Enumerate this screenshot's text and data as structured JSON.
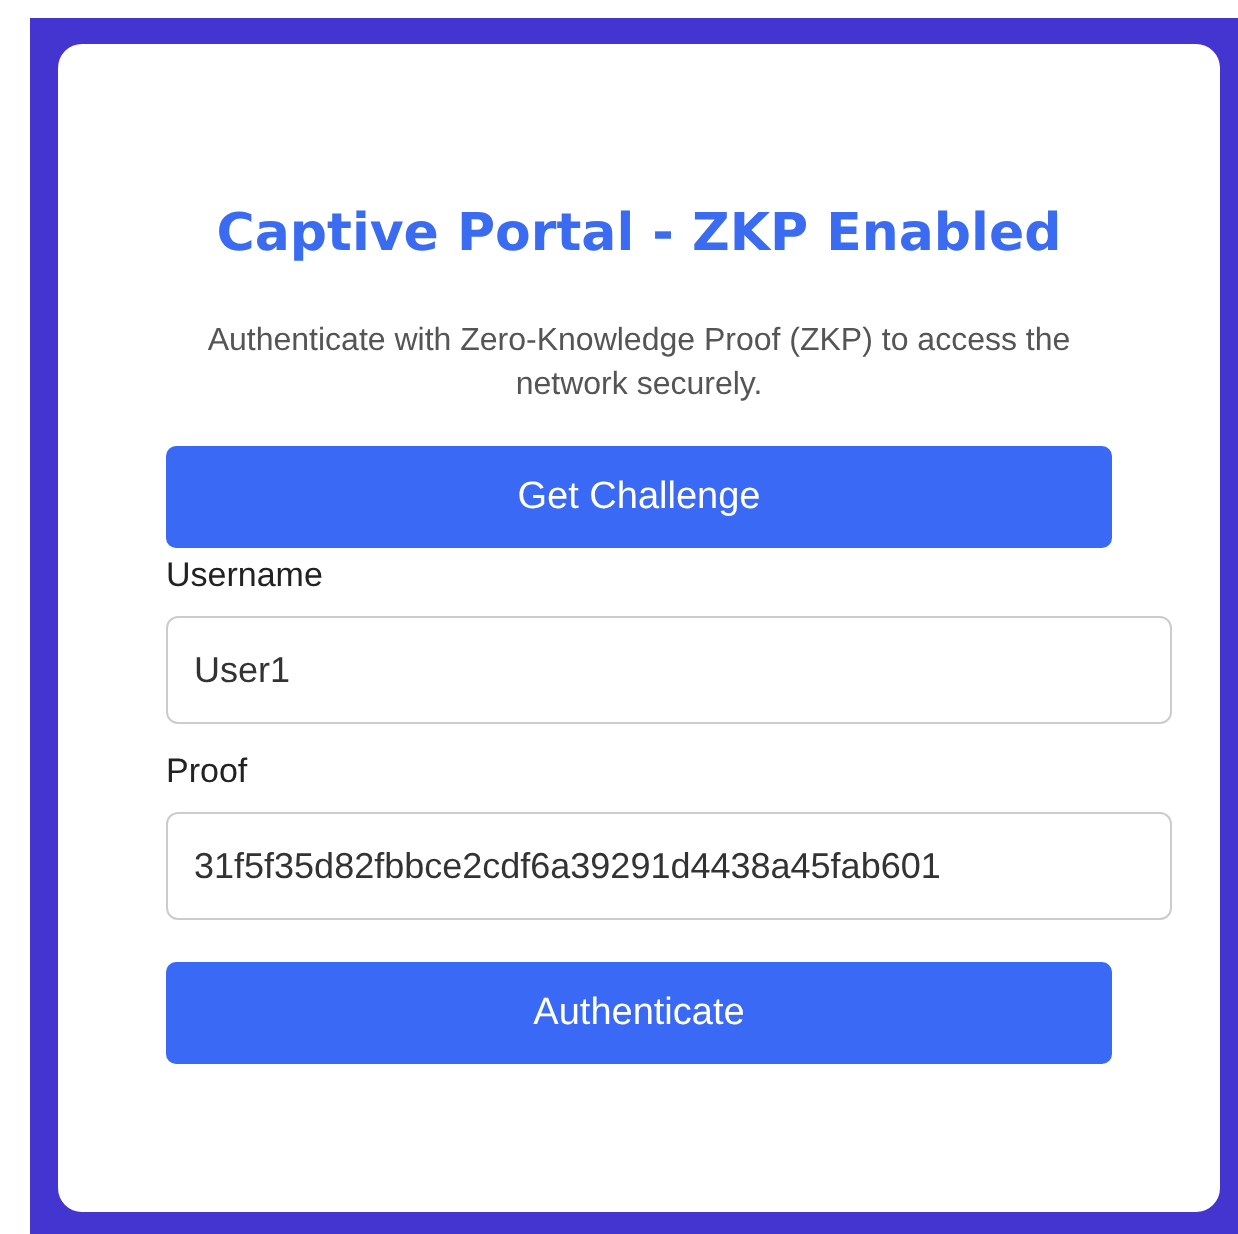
{
  "title": "Captive Portal - ZKP Enabled",
  "description": "Authenticate with Zero-Knowledge Proof (ZKP) to access the network securely.",
  "challenge_button": "Get Challenge",
  "fields": [
    {
      "label": "Username",
      "value": "User1"
    },
    {
      "label": "Proof",
      "value": "31f5f35d82fbbce2cdf6a39291d4438a45fab601"
    }
  ],
  "submit_button": "Authenticate"
}
